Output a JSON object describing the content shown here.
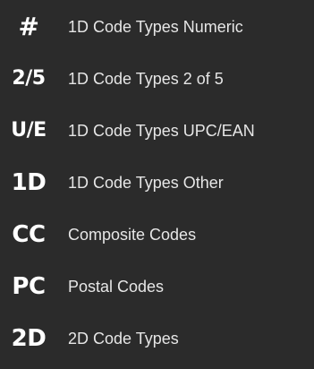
{
  "menu": {
    "items": [
      {
        "icon_text": "#",
        "icon_name": "hash-icon",
        "label": "1D Code Types Numeric"
      },
      {
        "icon_text": "2/5",
        "icon_name": "two-of-five-icon",
        "label": "1D Code Types 2 of 5"
      },
      {
        "icon_text": "U/E",
        "icon_name": "upc-ean-icon",
        "label": "1D Code Types UPC/EAN"
      },
      {
        "icon_text": "1D",
        "icon_name": "one-d-icon",
        "label": "1D Code Types Other"
      },
      {
        "icon_text": "CC",
        "icon_name": "composite-codes-icon",
        "label": "Composite Codes"
      },
      {
        "icon_text": "PC",
        "icon_name": "postal-codes-icon",
        "label": "Postal Codes"
      },
      {
        "icon_text": "2D",
        "icon_name": "two-d-icon",
        "label": "2D Code Types"
      }
    ]
  },
  "colors": {
    "background": "#2b2b2b",
    "icon": "#ffffff",
    "label": "#e6e6e6"
  }
}
